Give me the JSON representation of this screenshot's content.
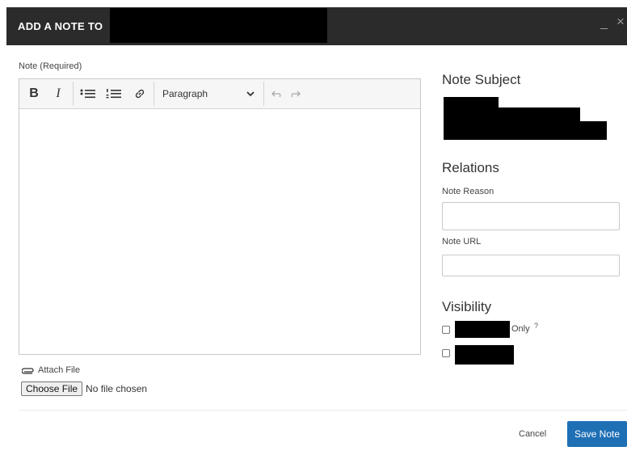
{
  "dialog": {
    "title": "ADD A NOTE TO",
    "minimize_glyph": "_",
    "close_glyph": "×"
  },
  "editor": {
    "label": "Note (Required)",
    "toolbar": {
      "bold": "B",
      "italic": "I",
      "bulleted_list_icon": "bulleted-list-icon",
      "numbered_list_icon": "numbered-list-icon",
      "link_icon": "link-icon",
      "paragraph_select": "Paragraph",
      "undo_icon": "undo-icon",
      "redo_icon": "redo-icon"
    },
    "content": ""
  },
  "attachment": {
    "attach_label": "Attach File",
    "choose_button": "Choose File",
    "status": "No file chosen"
  },
  "right": {
    "subject_heading": "Note Subject",
    "relations_heading": "Relations",
    "reason_label": "Note Reason",
    "reason_value": "",
    "url_label": "Note URL",
    "url_value": "",
    "visibility_heading": "Visibility",
    "visibility_option1_suffix": "Only",
    "visibility_help": "?"
  },
  "footer": {
    "cancel_label": "Cancel",
    "save_label": "Save Note"
  },
  "colors": {
    "header_bg": "#2b2b2b",
    "primary_button": "#1f6fb5"
  }
}
